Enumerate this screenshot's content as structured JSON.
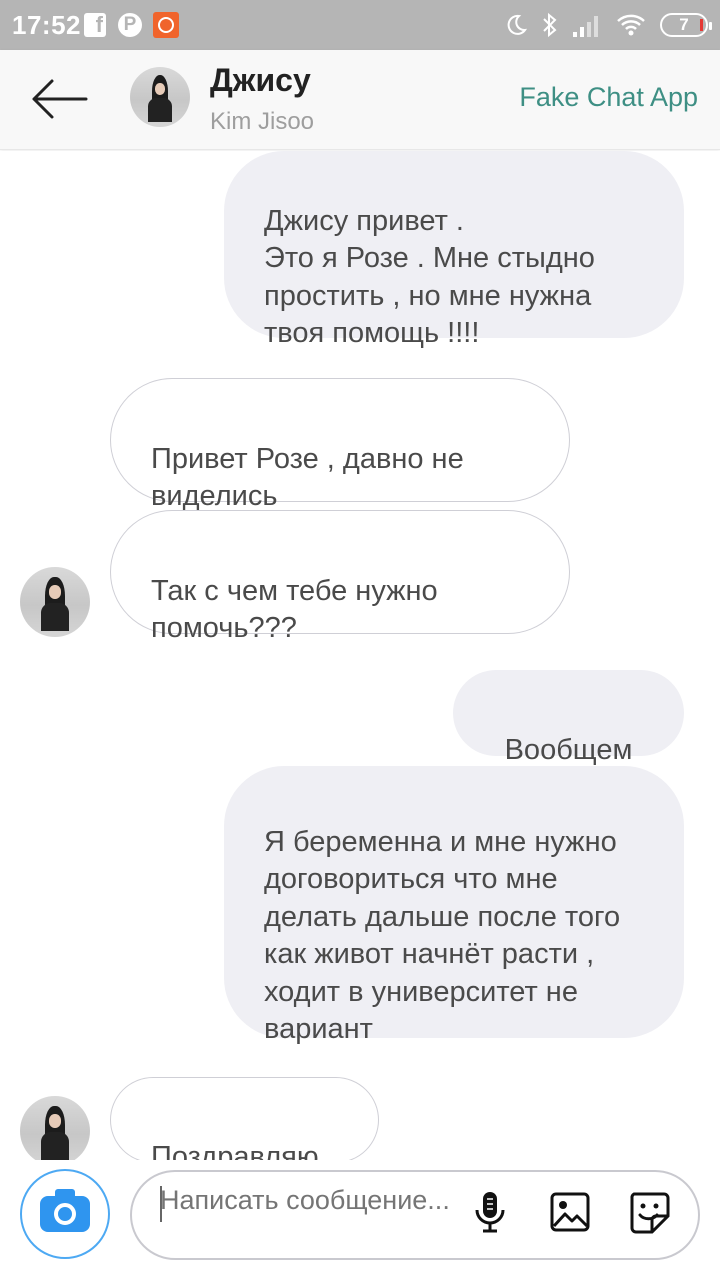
{
  "status_bar": {
    "time": "17:52",
    "battery": "7",
    "icons": [
      "facebook-icon",
      "pinterest-icon",
      "app-notification-icon",
      "moon-icon",
      "bluetooth-icon",
      "signal-icon",
      "wifi-icon",
      "battery-icon"
    ]
  },
  "header": {
    "back_icon": "arrow-left-icon",
    "contact_name": "Джису",
    "contact_sub": "Kim Jisoo",
    "brand": "Fake Chat App"
  },
  "messages": [
    {
      "side": "out",
      "text": "Джису привет .\nЭто я Розе . Мне стыдно простить , но мне нужна твоя помощь !!!!"
    },
    {
      "side": "in",
      "text": "Привет Розе , давно не виделись"
    },
    {
      "side": "in",
      "text": "Так с чем тебе нужно помочь???",
      "avatar": true
    },
    {
      "side": "out",
      "text": "Вообщем"
    },
    {
      "side": "out",
      "text": "Я беременна и мне нужно договориться что мне делать дальше после того как живот начнёт расти , ходит в университет не вариант"
    },
    {
      "side": "in",
      "text": "Поздравляю",
      "avatar": true
    }
  ],
  "composer": {
    "placeholder": "Написать сообщение...",
    "icons": [
      "camera-icon",
      "microphone-icon",
      "image-icon",
      "sticker-icon"
    ]
  },
  "colors": {
    "status_bar": "#b5b5b5",
    "brand": "#3e8f84",
    "outgoing_bubble": "#efeff4",
    "incoming_border": "#cfcfd6",
    "camera_accent": "#2f95ef"
  }
}
